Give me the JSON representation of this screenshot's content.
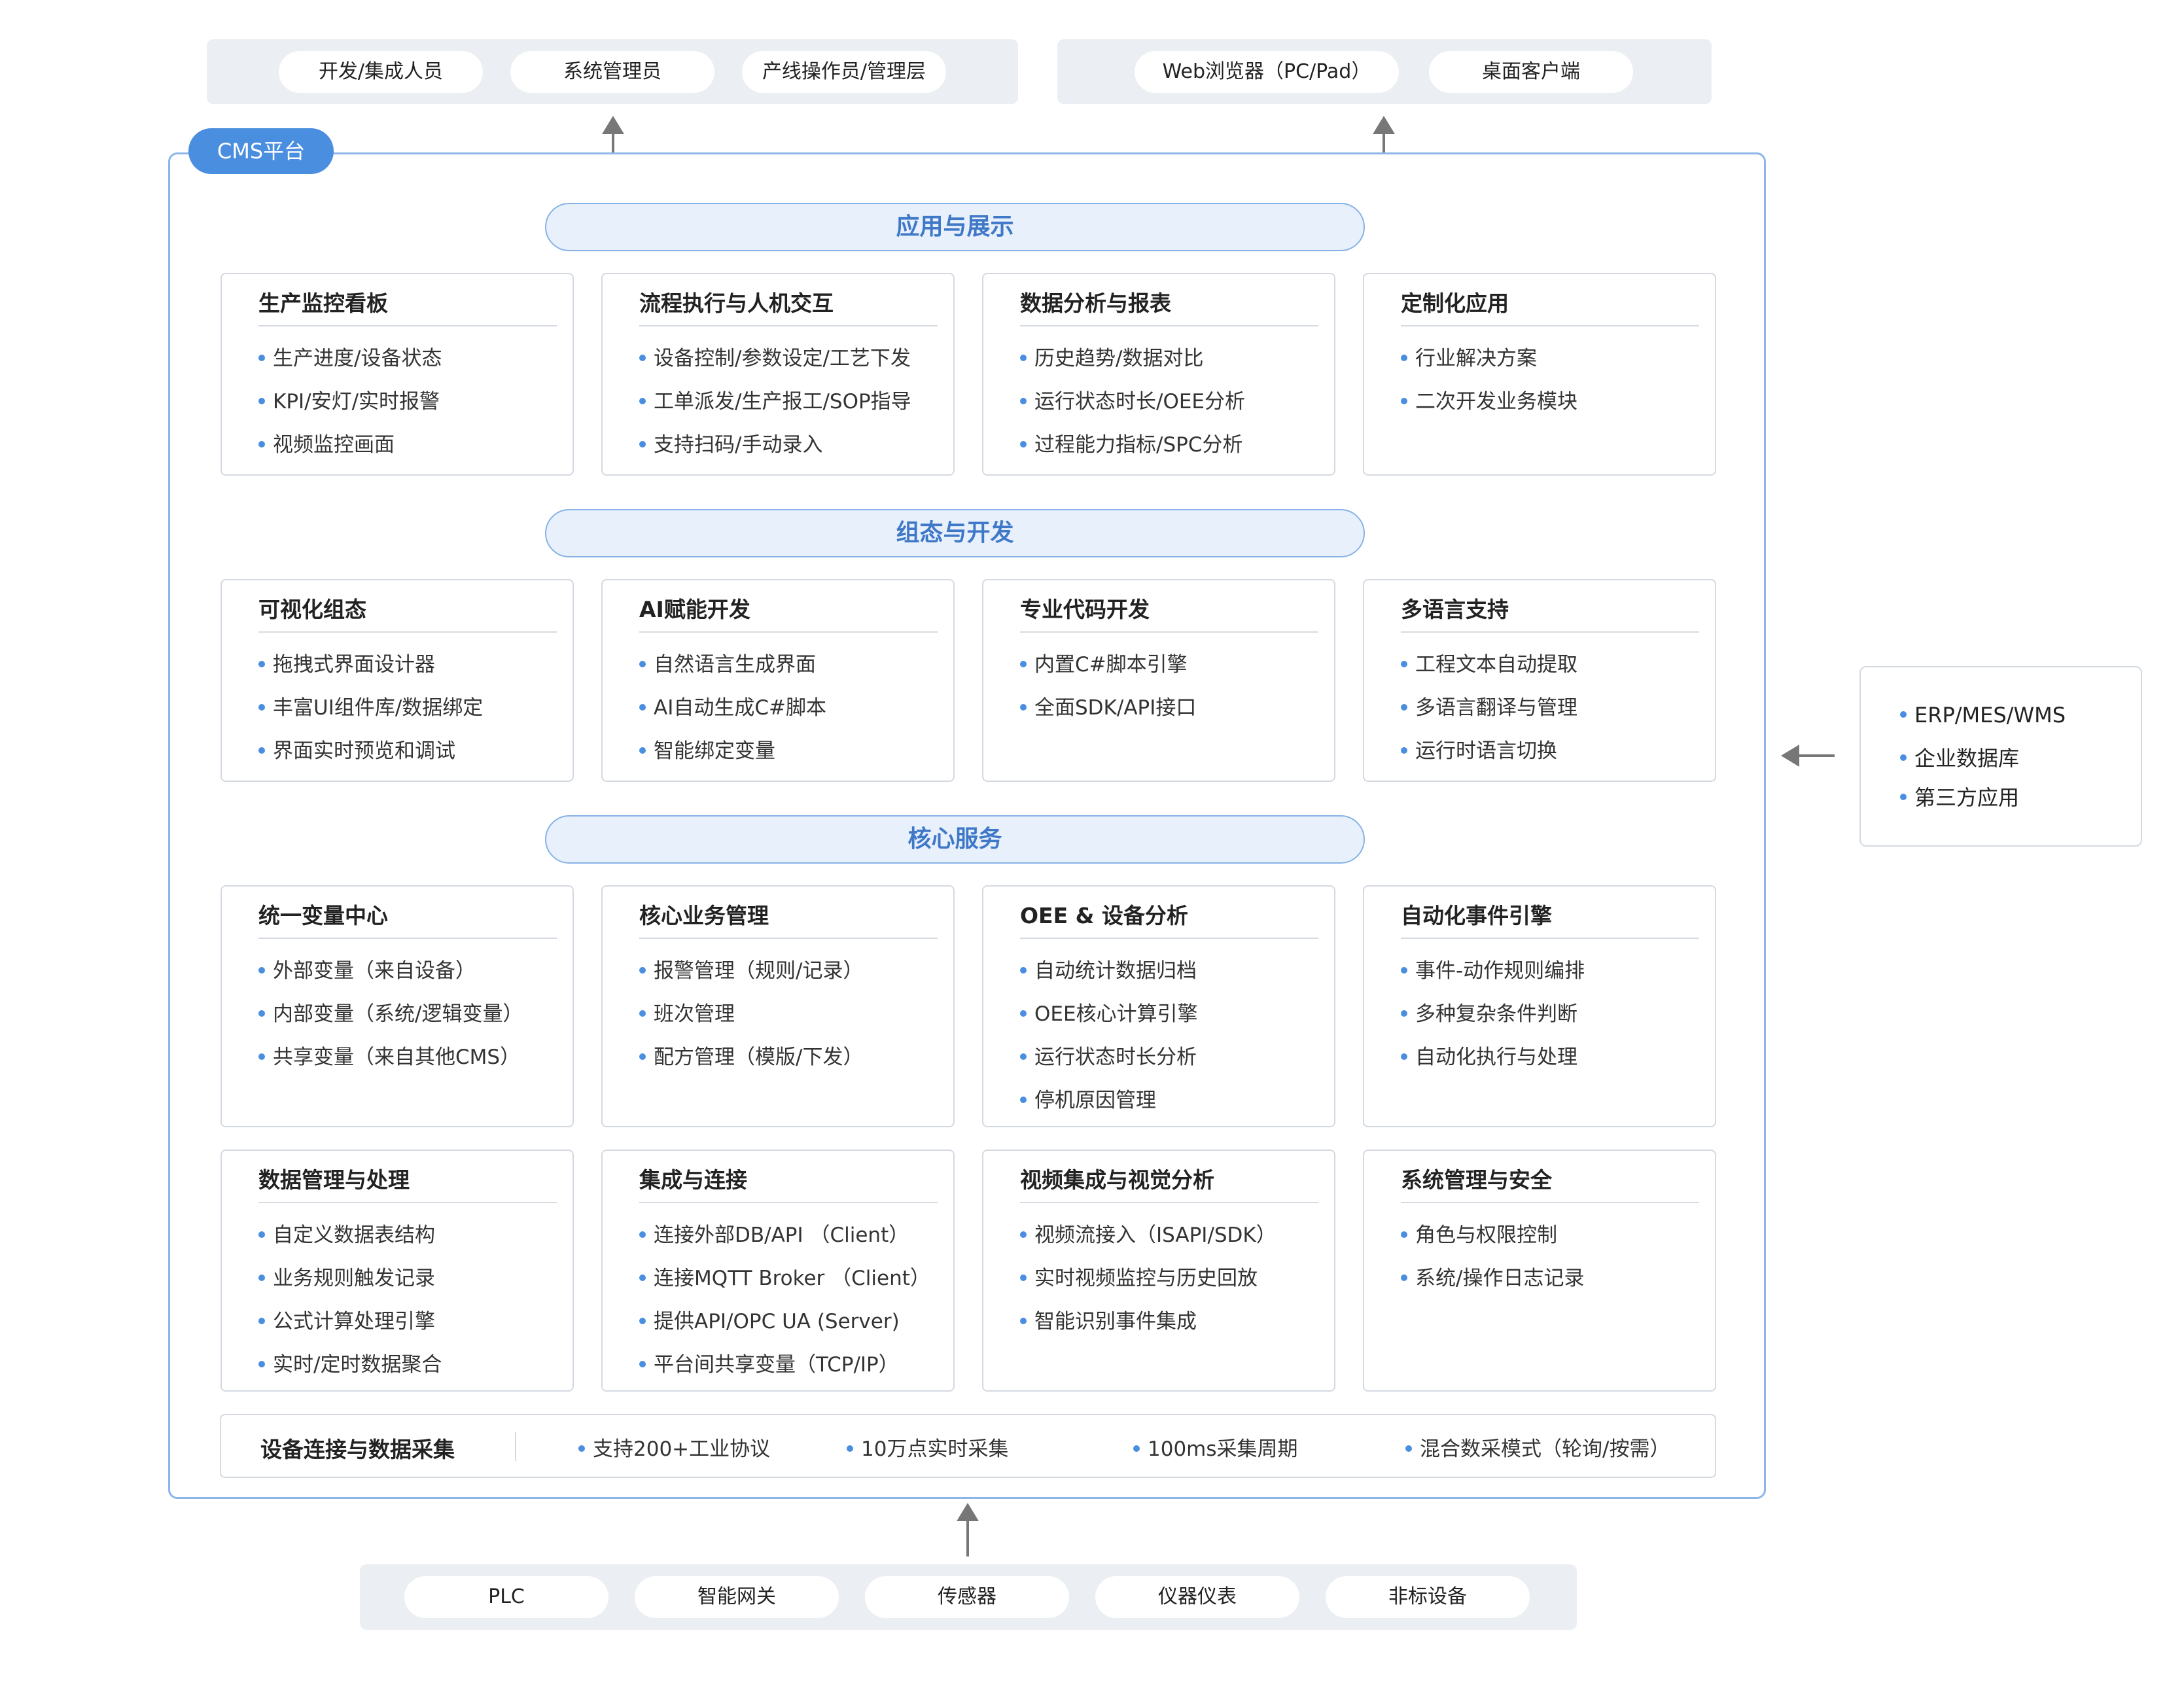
{
  "users": {
    "group1": [
      "开发/集成人员",
      "系统管理员",
      "产线操作员/管理层"
    ],
    "group2": [
      "Web浏览器（PC/Pad）",
      "桌面客户端"
    ]
  },
  "platform_label": "CMS平台",
  "sections": {
    "app": "应用与展示",
    "config": "组态与开发",
    "core": "核心服务"
  },
  "app_cards": [
    {
      "title": "生产监控看板",
      "items": [
        "生产进度/设备状态",
        "KPI/安灯/实时报警",
        "视频监控画面"
      ]
    },
    {
      "title": "流程执行与人机交互",
      "items": [
        "设备控制/参数设定/工艺下发",
        "工单派发/生产报工/SOP指导",
        "支持扫码/手动录入"
      ]
    },
    {
      "title": "数据分析与报表",
      "items": [
        "历史趋势/数据对比",
        "运行状态时长/OEE分析",
        "过程能力指标/SPC分析"
      ]
    },
    {
      "title": "定制化应用",
      "items": [
        "行业解决方案",
        "二次开发业务模块"
      ]
    }
  ],
  "config_cards": [
    {
      "title": "可视化组态",
      "items": [
        "拖拽式界面设计器",
        "丰富UI组件库/数据绑定",
        "界面实时预览和调试"
      ]
    },
    {
      "title": "AI赋能开发",
      "items": [
        "自然语言生成界面",
        "AI自动生成C#脚本",
        "智能绑定变量"
      ]
    },
    {
      "title": "专业代码开发",
      "items": [
        "内置C#脚本引擎",
        "全面SDK/API接口"
      ]
    },
    {
      "title": "多语言支持",
      "items": [
        "工程文本自动提取",
        "多语言翻译与管理",
        "运行时语言切换"
      ]
    }
  ],
  "core_cards_row1": [
    {
      "title": "统一变量中心",
      "items": [
        "外部变量（来自设备）",
        "内部变量（系统/逻辑变量）",
        "共享变量（来自其他CMS）"
      ]
    },
    {
      "title": "核心业务管理",
      "items": [
        "报警管理（规则/记录）",
        "班次管理",
        "配方管理（模版/下发）"
      ]
    },
    {
      "title": "OEE & 设备分析",
      "items": [
        "自动统计数据归档",
        "OEE核心计算引擎",
        "运行状态时长分析",
        "停机原因管理"
      ]
    },
    {
      "title": "自动化事件引擎",
      "items": [
        "事件-动作规则编排",
        "多种复杂条件判断",
        "自动化执行与处理"
      ]
    }
  ],
  "core_cards_row2": [
    {
      "title": "数据管理与处理",
      "items": [
        "自定义数据表结构",
        "业务规则触发记录",
        "公式计算处理引擎",
        "实时/定时数据聚合"
      ]
    },
    {
      "title": "集成与连接",
      "items": [
        "连接外部DB/API （Client）",
        "连接MQTT Broker （Client）",
        "提供API/OPC UA (Server)",
        "平台间共享变量（TCP/IP）"
      ]
    },
    {
      "title": "视频集成与视觉分析",
      "items": [
        "视频流接入（ISAPI/SDK）",
        "实时视频监控与历史回放",
        "智能识别事件集成"
      ]
    },
    {
      "title": "系统管理与安全",
      "items": [
        "角色与权限控制",
        "系统/操作日志记录"
      ]
    }
  ],
  "device_layer": {
    "title": "设备连接与数据采集",
    "items": [
      "支持200+工业协议",
      "10万点实时采集",
      "100ms采集周期",
      "混合数采模式（轮询/按需）"
    ]
  },
  "external": [
    "ERP/MES/WMS",
    "企业数据库",
    "第三方应用"
  ],
  "devices": [
    "PLC",
    "智能网关",
    "传感器",
    "仪器仪表",
    "非标设备"
  ],
  "colors": {
    "accent": "#4a8ee0",
    "section_text": "#3f78c8",
    "section_bg": "#e7f0fb",
    "group_bg": "#ebeef2"
  }
}
